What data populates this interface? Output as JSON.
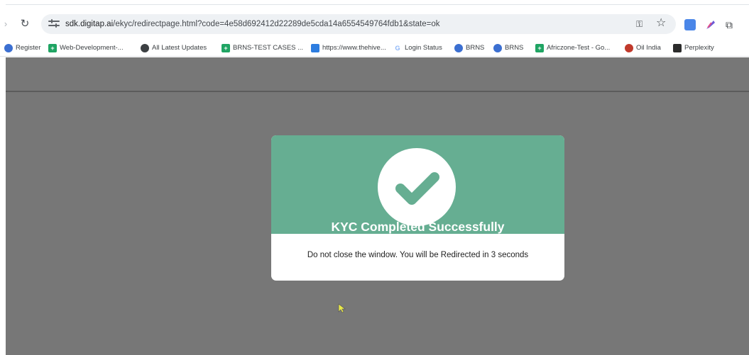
{
  "browser": {
    "url_host": "sdk.digitap.ai",
    "url_rest": "/ekyc/redirectpage.html?code=4e58d692412d22289de5cda14a6554549764fdb1&state=ok"
  },
  "bookmarks": [
    {
      "label": "Register",
      "icon": "globe-icon"
    },
    {
      "label": "Web-Development-...",
      "icon": "sheets-icon"
    },
    {
      "label": "All Latest Updates",
      "icon": "world-icon"
    },
    {
      "label": "BRNS-TEST CASES ...",
      "icon": "sheets-icon"
    },
    {
      "label": "https://www.thehive...",
      "icon": "site-icon"
    },
    {
      "label": "Login Status",
      "icon": "login-icon"
    },
    {
      "label": "BRNS",
      "icon": "globe-icon"
    },
    {
      "label": "BRNS",
      "icon": "globe-icon"
    },
    {
      "label": "Africzone-Test - Go...",
      "icon": "sheets-icon"
    },
    {
      "label": "Oil India",
      "icon": "oil-india-icon"
    },
    {
      "label": "Perplexity",
      "icon": "perplexity-icon"
    }
  ],
  "modal": {
    "title": "KYC Completed Successfully",
    "message": "Do not close the window. You will be Redirected in 3 seconds",
    "accent_color": "#66ae92"
  }
}
